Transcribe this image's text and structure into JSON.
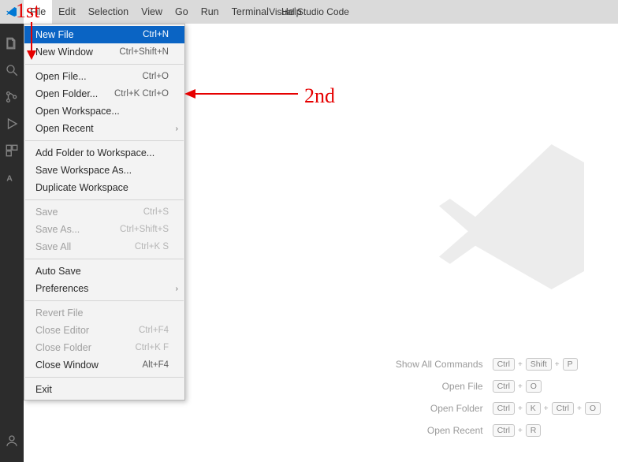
{
  "window": {
    "title": "Visual Studio Code"
  },
  "menubar": {
    "items": [
      "File",
      "Edit",
      "Selection",
      "View",
      "Go",
      "Run",
      "Terminal",
      "Help"
    ]
  },
  "fileMenu": {
    "groups": [
      [
        {
          "label": "New File",
          "shortcut": "Ctrl+N",
          "enabled": true,
          "highlight": true,
          "submenu": false
        },
        {
          "label": "New Window",
          "shortcut": "Ctrl+Shift+N",
          "enabled": true,
          "highlight": false,
          "submenu": false
        }
      ],
      [
        {
          "label": "Open File...",
          "shortcut": "Ctrl+O",
          "enabled": true,
          "highlight": false,
          "submenu": false
        },
        {
          "label": "Open Folder...",
          "shortcut": "Ctrl+K Ctrl+O",
          "enabled": true,
          "highlight": false,
          "submenu": false
        },
        {
          "label": "Open Workspace...",
          "shortcut": "",
          "enabled": true,
          "highlight": false,
          "submenu": false
        },
        {
          "label": "Open Recent",
          "shortcut": "",
          "enabled": true,
          "highlight": false,
          "submenu": true
        }
      ],
      [
        {
          "label": "Add Folder to Workspace...",
          "shortcut": "",
          "enabled": true,
          "highlight": false,
          "submenu": false
        },
        {
          "label": "Save Workspace As...",
          "shortcut": "",
          "enabled": true,
          "highlight": false,
          "submenu": false
        },
        {
          "label": "Duplicate Workspace",
          "shortcut": "",
          "enabled": true,
          "highlight": false,
          "submenu": false
        }
      ],
      [
        {
          "label": "Save",
          "shortcut": "Ctrl+S",
          "enabled": false,
          "highlight": false,
          "submenu": false
        },
        {
          "label": "Save As...",
          "shortcut": "Ctrl+Shift+S",
          "enabled": false,
          "highlight": false,
          "submenu": false
        },
        {
          "label": "Save All",
          "shortcut": "Ctrl+K S",
          "enabled": false,
          "highlight": false,
          "submenu": false
        }
      ],
      [
        {
          "label": "Auto Save",
          "shortcut": "",
          "enabled": true,
          "highlight": false,
          "submenu": false
        },
        {
          "label": "Preferences",
          "shortcut": "",
          "enabled": true,
          "highlight": false,
          "submenu": true
        }
      ],
      [
        {
          "label": "Revert File",
          "shortcut": "",
          "enabled": false,
          "highlight": false,
          "submenu": false
        },
        {
          "label": "Close Editor",
          "shortcut": "Ctrl+F4",
          "enabled": false,
          "highlight": false,
          "submenu": false
        },
        {
          "label": "Close Folder",
          "shortcut": "Ctrl+K F",
          "enabled": false,
          "highlight": false,
          "submenu": false
        },
        {
          "label": "Close Window",
          "shortcut": "Alt+F4",
          "enabled": true,
          "highlight": false,
          "submenu": false
        }
      ],
      [
        {
          "label": "Exit",
          "shortcut": "",
          "enabled": true,
          "highlight": false,
          "submenu": false
        }
      ]
    ]
  },
  "welcome": {
    "shortcuts": [
      {
        "label": "Show All Commands",
        "keys": [
          "Ctrl",
          "Shift",
          "P"
        ]
      },
      {
        "label": "Open File",
        "keys": [
          "Ctrl",
          "O"
        ]
      },
      {
        "label": "Open Folder",
        "keys": [
          "Ctrl",
          "K",
          "Ctrl",
          "O"
        ]
      },
      {
        "label": "Open Recent",
        "keys": [
          "Ctrl",
          "R"
        ]
      }
    ]
  },
  "activity": {
    "top": [
      {
        "name": "files-icon"
      },
      {
        "name": "search-icon"
      },
      {
        "name": "source-control-icon"
      },
      {
        "name": "run-debug-icon"
      },
      {
        "name": "extensions-icon"
      },
      {
        "name": "ai-icon"
      }
    ],
    "bottom": [
      {
        "name": "account-icon"
      }
    ]
  },
  "annotations": {
    "first": "1st",
    "second": "2nd"
  }
}
